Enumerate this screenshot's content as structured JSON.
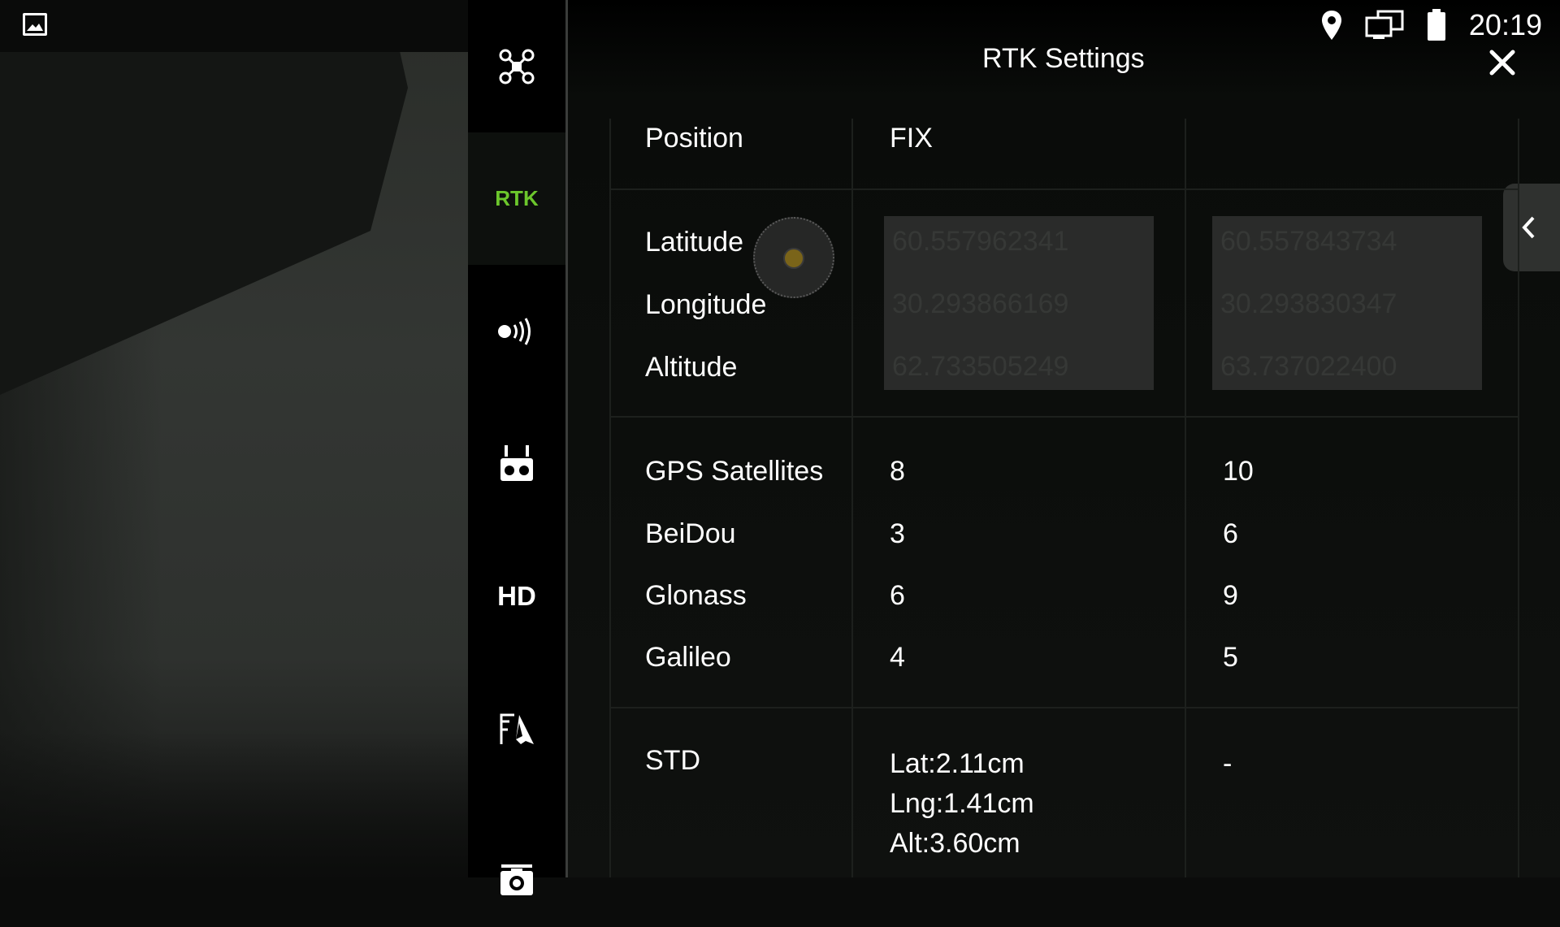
{
  "status_bar": {
    "time": "20:19"
  },
  "title": "RTK Settings",
  "sidebar": {
    "items": [
      {
        "id": "aircraft",
        "icon": "aircraft-icon"
      },
      {
        "id": "rtk",
        "label": "RTK",
        "active": true
      },
      {
        "id": "signal",
        "icon": "signal-icon"
      },
      {
        "id": "remote",
        "icon": "remote-controller-icon"
      },
      {
        "id": "hd",
        "label": "HD"
      },
      {
        "id": "general",
        "icon": "settings-navigation-icon"
      },
      {
        "id": "camera",
        "icon": "camera-icon"
      }
    ]
  },
  "table": {
    "position": {
      "label": "Position",
      "value": "FIX"
    },
    "coordinates": {
      "labels": [
        "Latitude",
        "Longitude",
        "Altitude"
      ],
      "col1": [
        "60.557962341",
        "30.293866169",
        "62.733505249"
      ],
      "col2": [
        "60.557843734",
        "30.293830347",
        "63.737022400"
      ]
    },
    "satellites": {
      "labels": [
        "GPS Satellites",
        "BeiDou",
        "Glonass",
        "Galileo"
      ],
      "col1": [
        "8",
        "3",
        "6",
        "4"
      ],
      "col2": [
        "10",
        "6",
        "9",
        "5"
      ]
    },
    "std": {
      "label": "STD",
      "col1": [
        "Lat:2.11cm",
        "Lng:1.41cm",
        "Alt:3.60cm"
      ],
      "col2": "-"
    }
  },
  "colors": {
    "accent_green": "#6cc72c",
    "panel": "#0f110f"
  }
}
